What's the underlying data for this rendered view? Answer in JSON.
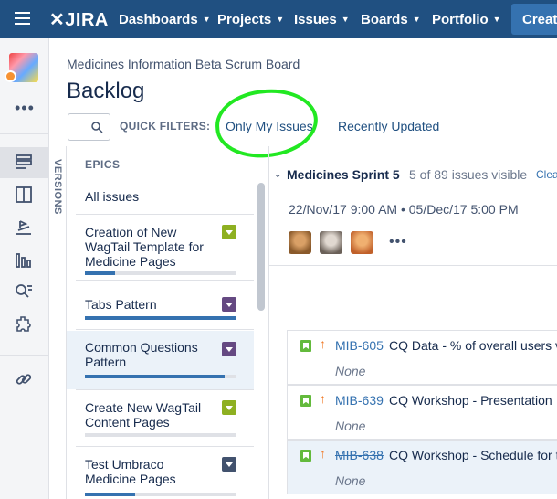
{
  "topbar": {
    "logo": "JIRA",
    "nav": [
      "Dashboards",
      "Projects",
      "Issues",
      "Boards",
      "Portfolio"
    ],
    "create_label": "Create"
  },
  "breadcrumb": "Medicines Information Beta Scrum Board",
  "page_title": "Backlog",
  "quick_filters": {
    "label": "QUICK FILTERS:",
    "filters": [
      "Only My Issues",
      "Recently Updated"
    ],
    "highlighted_filter": "Only My Issues",
    "highlight_color": "#22e822"
  },
  "versions_label": "VERSIONS",
  "epics": {
    "header": "EPICS",
    "all_label": "All issues",
    "items": [
      {
        "name": "Creation of New WagTail Template for Medicine Pages",
        "color": "#8eb021",
        "progress": 0.2,
        "selected": false
      },
      {
        "name": "Tabs Pattern",
        "color": "#654982",
        "progress": 1.0,
        "selected": false
      },
      {
        "name": "Common Questions Pattern",
        "color": "#654982",
        "progress": 0.92,
        "selected": true
      },
      {
        "name": "Create New WagTail Content Pages",
        "color": "#8eb021",
        "progress": 0.0,
        "selected": false
      },
      {
        "name": "Test Umbraco Medicine Pages",
        "color": "#42526e",
        "progress": 0.33,
        "selected": false
      }
    ]
  },
  "sprint": {
    "name": "Medicines Sprint 5",
    "visible": "5 of 89 issues visible",
    "clear": "Clea",
    "dates": "22/Nov/17 9:00 AM • 05/Dec/17 5:00 PM",
    "more": "•••"
  },
  "issues": [
    {
      "key": "MIB-605",
      "summary": "CQ Data - % of overall users v",
      "epic": "None",
      "done": false,
      "selected": false
    },
    {
      "key": "MIB-639",
      "summary": "CQ Workshop - Presentation",
      "epic": "None",
      "done": false,
      "selected": false
    },
    {
      "key": "MIB-638",
      "summary": "CQ Workshop - Schedule for t",
      "epic": "None",
      "done": true,
      "selected": true
    }
  ],
  "colors": {
    "header": "#205081",
    "link": "#3572b0",
    "story": "#63ba3c",
    "priority": "#f07a28"
  }
}
